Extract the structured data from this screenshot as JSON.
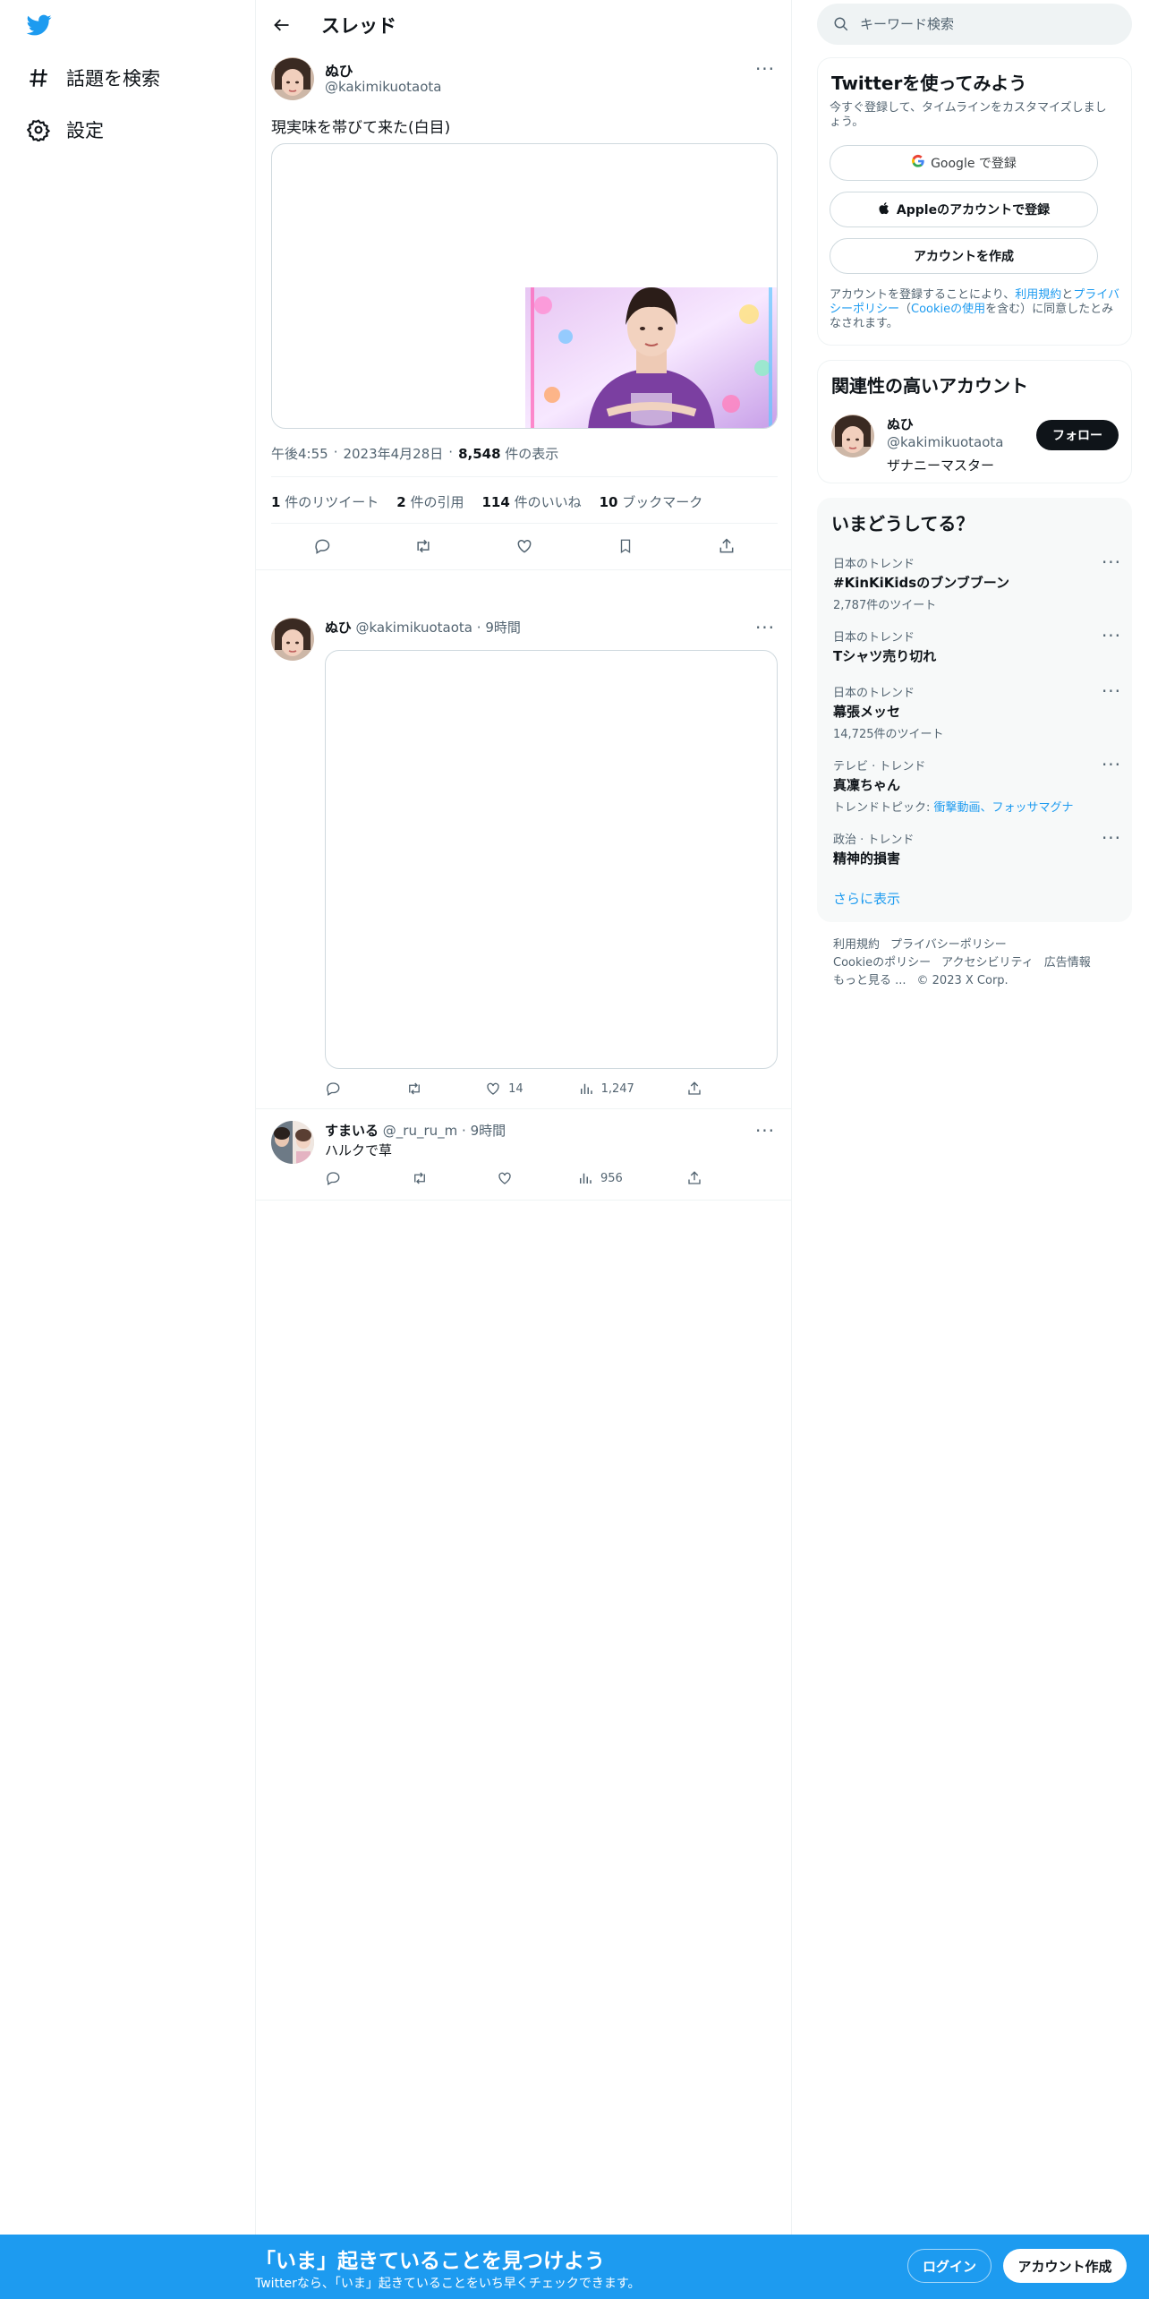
{
  "nav": {
    "items": [
      {
        "label": "話題を検索",
        "icon": "hashtag-icon"
      },
      {
        "label": "設定",
        "icon": "gear-icon"
      }
    ]
  },
  "thread": {
    "title": "スレッド",
    "main_tweet": {
      "name": "ぬひ",
      "handle": "@kakimikuotaota",
      "text": "現実味を帯びて来た(白目)",
      "time": "午後4:55",
      "date": "2023年4月28日",
      "views_count": "8,548",
      "views_label": "件の表示",
      "retweets_count": "1",
      "retweets_label": "件のリツイート",
      "quotes_count": "2",
      "quotes_label": "件の引用",
      "likes_count": "114",
      "likes_label": "件のいいね",
      "bookmarks_count": "10",
      "bookmarks_label": "ブックマーク"
    },
    "replies": [
      {
        "name": "ぬひ",
        "handle": "@kakimikuotaota",
        "time": "9時間",
        "text": "",
        "likes": "14",
        "views": "1,247"
      },
      {
        "name": "すまいる",
        "handle": "@_ru_ru_m",
        "time": "9時間",
        "text": "ハルクで草",
        "likes": "",
        "views": "956"
      }
    ]
  },
  "sidebar": {
    "search_placeholder": "キーワード検索",
    "signup_card": {
      "title": "Twitterを使ってみよう",
      "subtitle": "今すぐ登録して、タイムラインをカスタマイズしましょう。",
      "google_button": "Google で登録",
      "apple_button": "Appleのアカウントで登録",
      "create_button": "アカウントを作成",
      "legal_prefix": "アカウントを登録することにより、",
      "terms_link": "利用規約",
      "and": "と",
      "privacy_link": "プライバシーポリシー",
      "cookie_open": "（",
      "cookie_link": "Cookieの使用",
      "legal_suffix": "を含む）に同意したとみなされます。"
    },
    "related": {
      "title": "関連性の高いアカウント",
      "name": "ぬひ",
      "handle": "@kakimikuotaota",
      "bio": "ザナニーマスター",
      "follow_button": "フォロー"
    },
    "trends": {
      "title": "いまどうしてる？",
      "items": [
        {
          "category": "日本のトレンド",
          "name": "#KinKiKidsのブンブブーン",
          "count": "2,787件のツイート"
        },
        {
          "category": "日本のトレンド",
          "name": "Tシャツ売り切れ",
          "count": ""
        },
        {
          "category": "日本のトレンド",
          "name": "幕張メッセ",
          "count": "14,725件のツイート"
        },
        {
          "category": "テレビ · トレンド",
          "name": "真凜ちゃん",
          "topic_prefix": "トレンドトピック: ",
          "topic_links": "衝撃動画、フォッサマグナ"
        },
        {
          "category": "政治 · トレンド",
          "name": "精神的損害",
          "count": ""
        }
      ],
      "show_more": "さらに表示"
    },
    "footer": {
      "terms": "利用規約",
      "privacy": "プライバシーポリシー",
      "cookie": "Cookieのポリシー",
      "accessibility": "アクセシビリティ",
      "ads": "広告情報",
      "more": "もっと見る ...",
      "copyright": "© 2023 X Corp."
    }
  },
  "bottom_bar": {
    "title": "「いま」起きていることを見つけよう",
    "subtitle": "Twitterなら、「いま」起きていることをいち早くチェックできます。",
    "login": "ログイン",
    "signup": "アカウント作成"
  },
  "colors": {
    "accent": "#1d9bf0",
    "text": "#0f1419",
    "muted": "#536471"
  }
}
